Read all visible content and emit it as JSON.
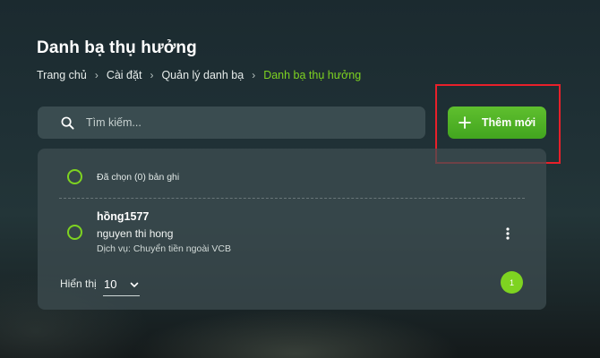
{
  "page": {
    "title": "Danh bạ thụ hưởng"
  },
  "breadcrumb": {
    "items": [
      "Trang chủ",
      "Cài đặt",
      "Quản lý danh bạ"
    ],
    "current": "Danh bạ thụ hưởng",
    "separator": "›"
  },
  "search": {
    "placeholder": "Tìm kiếm...",
    "value": "",
    "icon": "search-icon"
  },
  "toolbar": {
    "add_label": "Thêm mới",
    "add_icon": "plus-icon"
  },
  "list": {
    "selected_label": "Đã chọn (0) bản ghi",
    "items": [
      {
        "alias": "hồng1577",
        "name": "nguyen thi hong",
        "service": "Dịch vụ: Chuyển tiền ngoài VCB"
      }
    ]
  },
  "pagination": {
    "page_size_label": "Hiển thị",
    "page_size": "10",
    "current_page": "1"
  },
  "colors": {
    "accent": "#7ed321",
    "button": "#4caf28",
    "highlight": "#e8202a"
  }
}
